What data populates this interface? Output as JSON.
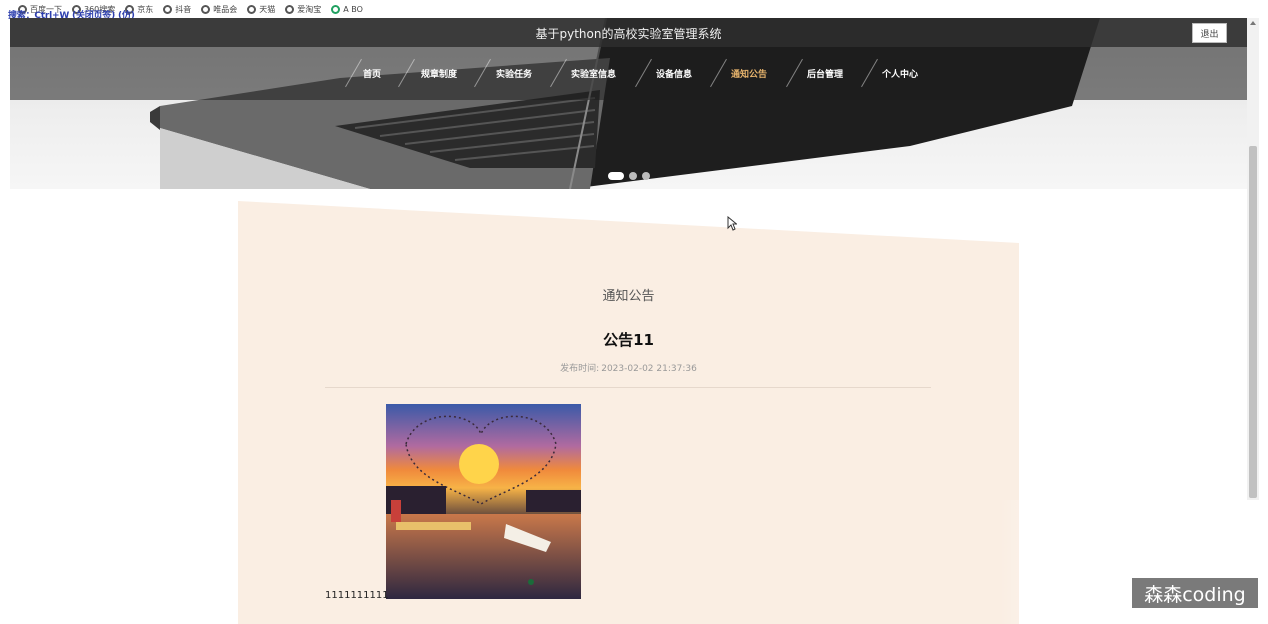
{
  "browser": {
    "overlay_text": "搜索：Ctrl+W (关闭页签) (仿)",
    "bookmarks": [
      {
        "label": "百度一下",
        "icon": "globe-icon"
      },
      {
        "label": "360搜索",
        "icon": "globe-icon"
      },
      {
        "label": "京东",
        "icon": "globe-icon"
      },
      {
        "label": "抖音",
        "icon": "globe-icon"
      },
      {
        "label": "唯品会",
        "icon": "globe-icon"
      },
      {
        "label": "天猫",
        "icon": "globe-icon"
      },
      {
        "label": "爱淘宝",
        "icon": "globe-icon"
      },
      {
        "label": "A BO",
        "icon": "leaf-icon"
      }
    ]
  },
  "header": {
    "site_title": "基于python的高校实验室管理系统",
    "logout_label": "退出"
  },
  "nav": {
    "items": [
      {
        "label": "首页"
      },
      {
        "label": "规章制度"
      },
      {
        "label": "实验任务"
      },
      {
        "label": "实验室信息"
      },
      {
        "label": "设备信息"
      },
      {
        "label": "通知公告",
        "active": true
      },
      {
        "label": "后台管理"
      },
      {
        "label": "个人中心"
      }
    ]
  },
  "banner": {
    "slide_count": 3,
    "active_slide": 1
  },
  "content": {
    "section_title": "通知公告",
    "notice_title": "公告11",
    "published_label": "发布时间:",
    "published_time": "2023-02-02 21:37:36",
    "body_text": "1111111111"
  },
  "watermark": "森森coding",
  "colors": {
    "nav_active": "#e6b36c",
    "card_background": "#faeee3",
    "topbar": "#2d2d2d"
  }
}
